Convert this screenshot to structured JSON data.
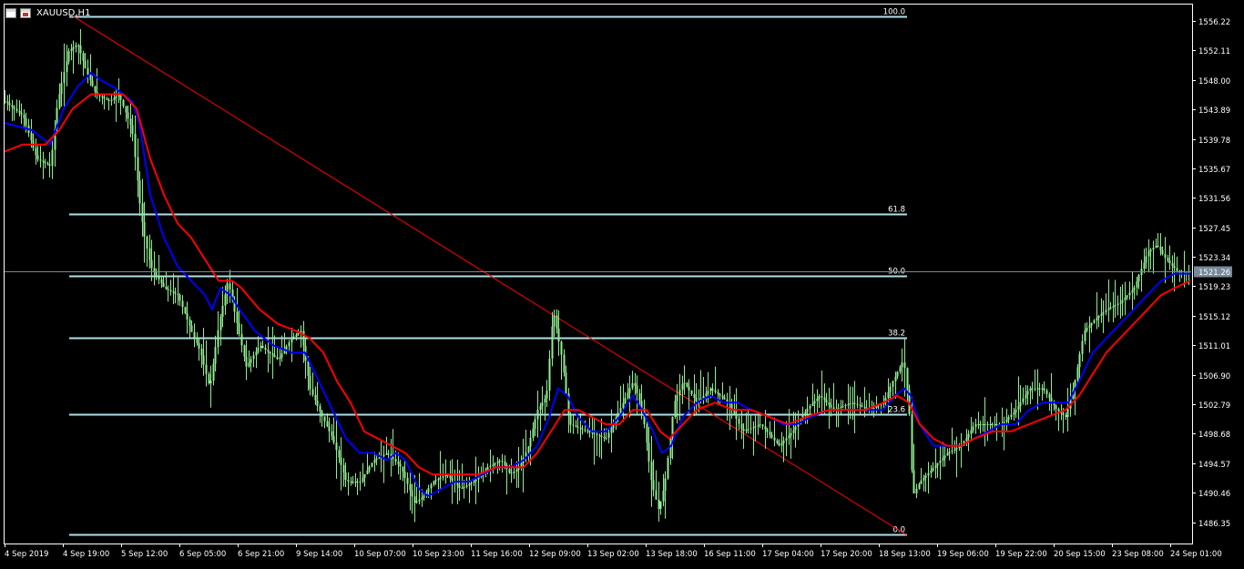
{
  "header": {
    "symbol": "XAUUSD,H1"
  },
  "icons": {
    "chart_window": "chart-window-icon",
    "chart_type": "chart-type-icon"
  },
  "colors": {
    "background": "#000000",
    "candle": "#90ee90",
    "ma_fast": "#0000ff",
    "ma_slow": "#ff0000",
    "fib_line": "#b0e0e6",
    "trend_line": "#ff0000",
    "current_price_line": "#778899",
    "axis": "#ffffff"
  },
  "chart_data": {
    "type": "line",
    "subtype": "candlestick",
    "symbol": "XAUUSD",
    "timeframe": "H1",
    "title": "XAUUSD,H1",
    "ylim": [
      1483.5,
      1558.5
    ],
    "grid": false,
    "x_labels": [
      "4 Sep 2019",
      "4 Sep 19:00",
      "5 Sep 12:00",
      "6 Sep 05:00",
      "6 Sep 21:00",
      "9 Sep 14:00",
      "10 Sep 07:00",
      "10 Sep 23:00",
      "11 Sep 16:00",
      "12 Sep 09:00",
      "13 Sep 02:00",
      "13 Sep 18:00",
      "16 Sep 11:00",
      "17 Sep 04:00",
      "17 Sep 20:00",
      "18 Sep 13:00",
      "19 Sep 06:00",
      "19 Sep 22:00",
      "20 Sep 15:00",
      "23 Sep 08:00",
      "24 Sep 01:00"
    ],
    "y_ticks": [
      "1556.22",
      "1552.11",
      "1548.00",
      "1543.89",
      "1539.78",
      "1535.67",
      "1531.56",
      "1527.45",
      "1523.34",
      "1519.23",
      "1515.12",
      "1511.01",
      "1506.90",
      "1502.79",
      "1498.68",
      "1494.57",
      "1490.46",
      "1486.35"
    ],
    "current_price": {
      "label": "1521.26",
      "value": 1521.26
    },
    "fibonacci": {
      "high": 1556.9,
      "low": 1484.6,
      "levels": [
        {
          "label": "100.0",
          "value": 1556.9
        },
        {
          "label": "61.8",
          "value": 1529.3
        },
        {
          "label": "50.0",
          "value": 1520.7
        },
        {
          "label": "38.2",
          "value": 1512.0
        },
        {
          "label": "23.6",
          "value": 1501.4
        },
        {
          "label": "0.0",
          "value": 1484.6
        }
      ]
    },
    "trendline": {
      "from": {
        "bar": 75,
        "value": 1556.9
      },
      "to": {
        "bar": 990,
        "value": 1484.6
      }
    },
    "price_path": [
      [
        0,
        1545
      ],
      [
        20,
        1543
      ],
      [
        35,
        1537
      ],
      [
        50,
        1536
      ],
      [
        58,
        1545
      ],
      [
        70,
        1552
      ],
      [
        80,
        1553
      ],
      [
        90,
        1549
      ],
      [
        100,
        1546
      ],
      [
        115,
        1545
      ],
      [
        125,
        1546
      ],
      [
        140,
        1541
      ],
      [
        148,
        1531
      ],
      [
        152,
        1527
      ],
      [
        160,
        1522
      ],
      [
        175,
        1519
      ],
      [
        190,
        1518
      ],
      [
        205,
        1513
      ],
      [
        215,
        1510
      ],
      [
        225,
        1505
      ],
      [
        235,
        1514
      ],
      [
        245,
        1520
      ],
      [
        255,
        1514
      ],
      [
        265,
        1508
      ],
      [
        280,
        1511
      ],
      [
        300,
        1509
      ],
      [
        315,
        1512
      ],
      [
        325,
        1513
      ],
      [
        335,
        1505
      ],
      [
        345,
        1502
      ],
      [
        360,
        1498
      ],
      [
        375,
        1492
      ],
      [
        390,
        1492
      ],
      [
        405,
        1495
      ],
      [
        420,
        1496
      ],
      [
        435,
        1494
      ],
      [
        450,
        1489
      ],
      [
        460,
        1490
      ],
      [
        470,
        1492
      ],
      [
        485,
        1493
      ],
      [
        500,
        1491
      ],
      [
        515,
        1492
      ],
      [
        530,
        1494
      ],
      [
        545,
        1495
      ],
      [
        555,
        1493
      ],
      [
        565,
        1494
      ],
      [
        575,
        1497
      ],
      [
        585,
        1502
      ],
      [
        595,
        1504
      ],
      [
        602,
        1516
      ],
      [
        612,
        1509
      ],
      [
        620,
        1500
      ],
      [
        640,
        1499
      ],
      [
        660,
        1498
      ],
      [
        675,
        1502
      ],
      [
        690,
        1506
      ],
      [
        700,
        1502
      ],
      [
        710,
        1492
      ],
      [
        718,
        1488
      ],
      [
        725,
        1492
      ],
      [
        735,
        1503
      ],
      [
        745,
        1506
      ],
      [
        760,
        1503
      ],
      [
        775,
        1505
      ],
      [
        795,
        1503
      ],
      [
        810,
        1499
      ],
      [
        830,
        1500
      ],
      [
        850,
        1497
      ],
      [
        865,
        1499
      ],
      [
        880,
        1502
      ],
      [
        895,
        1504
      ],
      [
        910,
        1502
      ],
      [
        930,
        1503
      ],
      [
        950,
        1502
      ],
      [
        965,
        1503
      ],
      [
        975,
        1506
      ],
      [
        987,
        1509
      ],
      [
        993,
        1502
      ],
      [
        997,
        1490
      ],
      [
        1005,
        1492
      ],
      [
        1020,
        1494
      ],
      [
        1035,
        1496
      ],
      [
        1050,
        1497
      ],
      [
        1065,
        1500
      ],
      [
        1080,
        1500
      ],
      [
        1095,
        1500
      ],
      [
        1110,
        1502
      ],
      [
        1125,
        1505
      ],
      [
        1140,
        1505
      ],
      [
        1155,
        1502
      ],
      [
        1165,
        1501
      ],
      [
        1175,
        1506
      ],
      [
        1185,
        1513
      ],
      [
        1200,
        1515
      ],
      [
        1210,
        1516
      ],
      [
        1225,
        1517
      ],
      [
        1240,
        1519
      ],
      [
        1255,
        1524
      ],
      [
        1265,
        1525
      ],
      [
        1275,
        1523
      ],
      [
        1290,
        1521
      ],
      [
        1302,
        1521.3
      ]
    ],
    "series": [
      {
        "name": "",
        "color": "#0000ff",
        "values": [
          [
            0,
            1542
          ],
          [
            30,
            1541
          ],
          [
            50,
            1539
          ],
          [
            65,
            1544
          ],
          [
            80,
            1547
          ],
          [
            95,
            1549
          ],
          [
            105,
            1548
          ],
          [
            120,
            1547
          ],
          [
            140,
            1545
          ],
          [
            148,
            1542
          ],
          [
            160,
            1532
          ],
          [
            175,
            1526
          ],
          [
            190,
            1522
          ],
          [
            205,
            1520
          ],
          [
            220,
            1518
          ],
          [
            228,
            1516
          ],
          [
            237,
            1519
          ],
          [
            248,
            1518
          ],
          [
            258,
            1516
          ],
          [
            275,
            1513
          ],
          [
            295,
            1511
          ],
          [
            315,
            1510
          ],
          [
            330,
            1510
          ],
          [
            345,
            1506
          ],
          [
            360,
            1502
          ],
          [
            375,
            1498
          ],
          [
            390,
            1496
          ],
          [
            405,
            1496
          ],
          [
            420,
            1495
          ],
          [
            430,
            1496
          ],
          [
            440,
            1495
          ],
          [
            455,
            1491
          ],
          [
            465,
            1490
          ],
          [
            480,
            1491
          ],
          [
            495,
            1492
          ],
          [
            510,
            1492
          ],
          [
            525,
            1493
          ],
          [
            540,
            1494
          ],
          [
            555,
            1494
          ],
          [
            570,
            1495
          ],
          [
            585,
            1497
          ],
          [
            598,
            1501
          ],
          [
            608,
            1505
          ],
          [
            618,
            1504
          ],
          [
            630,
            1501
          ],
          [
            645,
            1499
          ],
          [
            660,
            1499
          ],
          [
            675,
            1501
          ],
          [
            690,
            1504
          ],
          [
            700,
            1502
          ],
          [
            712,
            1499
          ],
          [
            722,
            1496
          ],
          [
            732,
            1497
          ],
          [
            745,
            1501
          ],
          [
            760,
            1503
          ],
          [
            775,
            1504
          ],
          [
            790,
            1503
          ],
          [
            805,
            1503
          ],
          [
            820,
            1502
          ],
          [
            840,
            1501
          ],
          [
            855,
            1500
          ],
          [
            870,
            1500
          ],
          [
            885,
            1501
          ],
          [
            905,
            1502
          ],
          [
            925,
            1502
          ],
          [
            945,
            1502
          ],
          [
            965,
            1502
          ],
          [
            978,
            1504
          ],
          [
            988,
            1505
          ],
          [
            995,
            1504
          ],
          [
            1005,
            1500
          ],
          [
            1020,
            1497
          ],
          [
            1035,
            1497
          ],
          [
            1050,
            1497
          ],
          [
            1065,
            1498
          ],
          [
            1080,
            1499
          ],
          [
            1095,
            1500
          ],
          [
            1110,
            1500
          ],
          [
            1125,
            1502
          ],
          [
            1140,
            1503
          ],
          [
            1155,
            1503
          ],
          [
            1168,
            1503
          ],
          [
            1180,
            1506
          ],
          [
            1195,
            1510
          ],
          [
            1210,
            1512
          ],
          [
            1225,
            1514
          ],
          [
            1240,
            1516
          ],
          [
            1255,
            1518
          ],
          [
            1270,
            1520
          ],
          [
            1285,
            1521
          ],
          [
            1302,
            1521
          ]
        ]
      },
      {
        "name": "",
        "color": "#ff0000",
        "values": [
          [
            0,
            1538
          ],
          [
            20,
            1539
          ],
          [
            45,
            1539
          ],
          [
            60,
            1541
          ],
          [
            75,
            1544
          ],
          [
            95,
            1546
          ],
          [
            115,
            1546
          ],
          [
            130,
            1546
          ],
          [
            145,
            1544
          ],
          [
            160,
            1537
          ],
          [
            175,
            1532
          ],
          [
            190,
            1528
          ],
          [
            205,
            1526
          ],
          [
            220,
            1523
          ],
          [
            235,
            1520
          ],
          [
            250,
            1520
          ],
          [
            260,
            1519
          ],
          [
            280,
            1516
          ],
          [
            300,
            1514
          ],
          [
            320,
            1513
          ],
          [
            335,
            1512
          ],
          [
            350,
            1510
          ],
          [
            365,
            1506
          ],
          [
            380,
            1503
          ],
          [
            395,
            1499
          ],
          [
            410,
            1498
          ],
          [
            425,
            1497
          ],
          [
            440,
            1496
          ],
          [
            455,
            1494
          ],
          [
            470,
            1493
          ],
          [
            490,
            1493
          ],
          [
            505,
            1493
          ],
          [
            520,
            1493
          ],
          [
            540,
            1494
          ],
          [
            555,
            1494
          ],
          [
            570,
            1494
          ],
          [
            585,
            1496
          ],
          [
            600,
            1499
          ],
          [
            615,
            1502
          ],
          [
            630,
            1502
          ],
          [
            645,
            1501
          ],
          [
            660,
            1500
          ],
          [
            675,
            1500
          ],
          [
            690,
            1502
          ],
          [
            705,
            1502
          ],
          [
            720,
            1499
          ],
          [
            730,
            1498
          ],
          [
            745,
            1500
          ],
          [
            760,
            1502
          ],
          [
            780,
            1503
          ],
          [
            800,
            1502
          ],
          [
            820,
            1502
          ],
          [
            840,
            1501
          ],
          [
            860,
            1500
          ],
          [
            880,
            1501
          ],
          [
            905,
            1502
          ],
          [
            925,
            1502
          ],
          [
            945,
            1502
          ],
          [
            965,
            1503
          ],
          [
            980,
            1504
          ],
          [
            993,
            1503
          ],
          [
            1005,
            1500
          ],
          [
            1020,
            1498
          ],
          [
            1035,
            1497
          ],
          [
            1050,
            1497
          ],
          [
            1065,
            1498
          ],
          [
            1085,
            1499
          ],
          [
            1105,
            1499
          ],
          [
            1125,
            1500
          ],
          [
            1145,
            1501
          ],
          [
            1165,
            1502
          ],
          [
            1180,
            1504
          ],
          [
            1195,
            1507
          ],
          [
            1210,
            1510
          ],
          [
            1225,
            1512
          ],
          [
            1240,
            1514
          ],
          [
            1255,
            1516
          ],
          [
            1270,
            1518
          ],
          [
            1285,
            1519
          ],
          [
            1302,
            1520
          ]
        ]
      }
    ]
  }
}
